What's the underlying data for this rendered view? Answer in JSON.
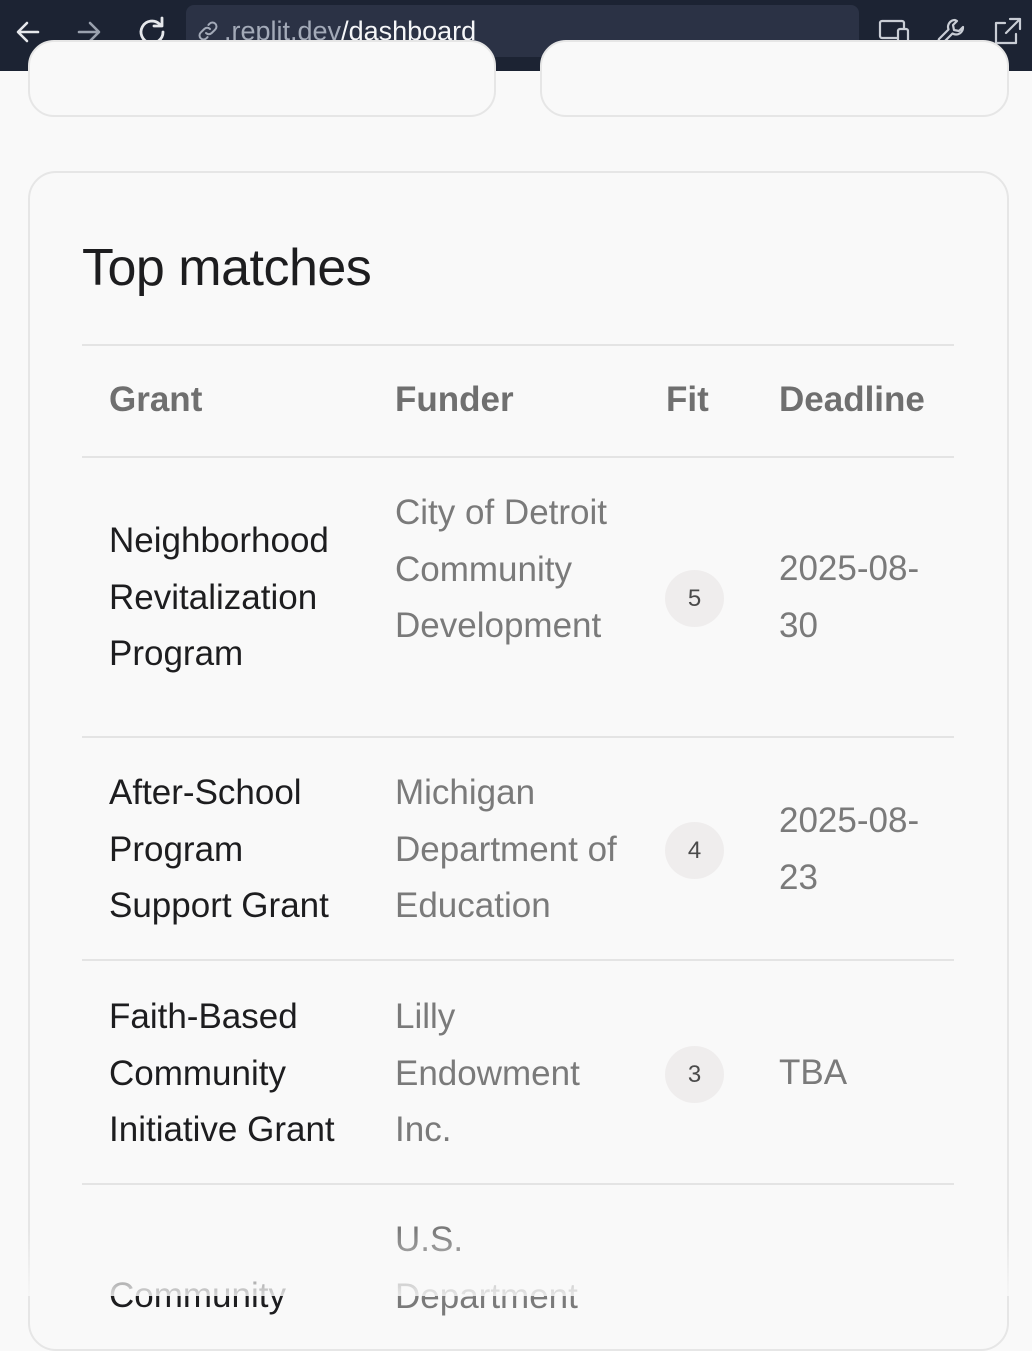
{
  "browser": {
    "url_host": ".replit.dev",
    "url_path": "/dashboard",
    "icons": [
      "back-arrow-icon",
      "forward-arrow-icon",
      "reload-icon",
      "link-icon",
      "devices-icon",
      "wrench-icon",
      "open-external-icon"
    ]
  },
  "panel": {
    "title": "Top matches",
    "columns": {
      "grant": "Grant",
      "funder": "Funder",
      "fit": "Fit",
      "deadline": "Deadline"
    },
    "rows": [
      {
        "grant": "Neighborhood Revitalization Program",
        "funder": "City of Detroit Community Development",
        "fit": "5",
        "deadline": "2025-08-30"
      },
      {
        "grant": "After-School Program Support Grant",
        "funder": "Michigan Department of Education",
        "fit": "4",
        "deadline": "2025-08-23"
      },
      {
        "grant": "Faith-Based Community Initiative Grant",
        "funder": "Lilly Endowment Inc.",
        "fit": "3",
        "deadline": "TBA"
      },
      {
        "grant": "Community",
        "funder": "U.S. Department",
        "fit": "",
        "deadline": ""
      }
    ]
  },
  "colors": {
    "chrome_bg": "#1c2333",
    "url_bar_bg": "#2b3245",
    "page_bg": "#f9f9f9",
    "badge_bg": "#efeded"
  }
}
